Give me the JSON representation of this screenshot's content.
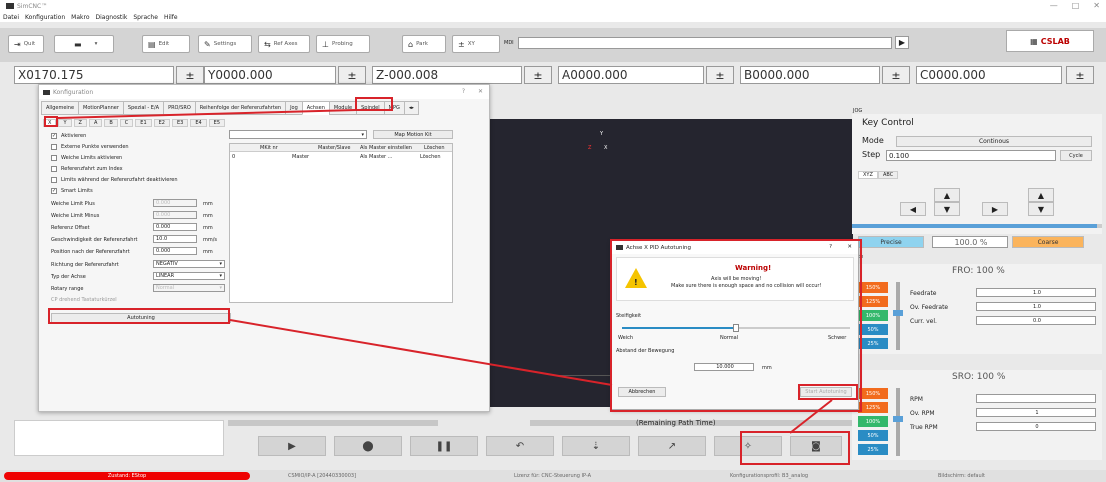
{
  "app": {
    "title": "SimCNC™"
  },
  "window_controls": {
    "minimize": "—",
    "maximize": "□",
    "close": "✕"
  },
  "menu": [
    "Datei",
    "Konfiguration",
    "Makro",
    "Diagnostik",
    "Sprache",
    "Hilfe"
  ],
  "toolbar": {
    "quit": "Quit",
    "edit": "Edit",
    "settings": "Settings",
    "ref_axes": "Ref Axes",
    "probing": "Probing",
    "park": "Park",
    "zero_xy": "XY",
    "mdi_label": "MDI"
  },
  "dro": [
    {
      "axis": "X",
      "value": "0170.175"
    },
    {
      "axis": "Y",
      "value": "0000.000"
    },
    {
      "axis": "Z",
      "value": "-000.008"
    },
    {
      "axis": "A",
      "value": "0000.000"
    },
    {
      "axis": "B",
      "value": "0000.000"
    },
    {
      "axis": "C",
      "value": "0000.000"
    }
  ],
  "config_dialog": {
    "title": "Konfiguration",
    "help": "?",
    "close": "✕",
    "tabs": [
      "Allgemeine",
      "MotionPlanner",
      "Spezial - E/A",
      "PRO/SRO",
      "Reihenfolge der Referenzfahrten",
      "Jog",
      "Achsen",
      "Module",
      "Spindel",
      "MPG"
    ],
    "subtabs": [
      "X",
      "Y",
      "Z",
      "A",
      "B",
      "C",
      "E1",
      "E2",
      "E3",
      "E4",
      "E5"
    ],
    "checks": [
      {
        "label": "Aktivieren",
        "checked": true
      },
      {
        "label": "Externe Punkte verwenden",
        "checked": false
      },
      {
        "label": "Weiche Limits aktivieren",
        "checked": false
      },
      {
        "label": "Referenzfahrt zum Index",
        "checked": false
      },
      {
        "label": "Limits während der Referenzfahrt deaktivieren",
        "checked": false
      },
      {
        "label": "Smart Limits",
        "checked": true
      }
    ],
    "fields": [
      {
        "label": "Weiche Limit Plus",
        "value": "0.000",
        "unit": "mm",
        "disabled": true
      },
      {
        "label": "Weiche Limit Minus",
        "value": "0.000",
        "unit": "mm",
        "disabled": true
      },
      {
        "label": "Referenz Offset",
        "value": "0.000",
        "unit": "mm",
        "disabled": false
      },
      {
        "label": "Geschwindigkeit der Referenzfahrt",
        "value": "10.0",
        "unit": "mm/s",
        "disabled": false
      },
      {
        "label": "Position nach der Referenzfahrt",
        "value": "0.000",
        "unit": "mm",
        "disabled": false
      }
    ],
    "selects": [
      {
        "label": "Richtung der Referenzfahrt",
        "value": "NEGATIV",
        "disabled": false
      },
      {
        "label": "Typ der Achse",
        "value": "LINEAR",
        "disabled": false
      },
      {
        "label": "Rotary range",
        "value": "Normal",
        "disabled": true
      }
    ],
    "extra_row": "CP drehend Tastaturkürzel",
    "autotuning": "Autotuning",
    "map_motion_kit": "Map Motion Kit",
    "table": {
      "headers": [
        "MKit nr",
        "Master/Slave",
        "Als Master einstellen",
        "Löschen"
      ],
      "rows": [
        [
          "0",
          "Master",
          "Als Master ...",
          "Löschen"
        ]
      ]
    }
  },
  "pid_dialog": {
    "title": "Achse X PID Autotuning",
    "help": "?",
    "close": "✕",
    "warning_title": "Warning!",
    "warning_line1": "Axis will be moving!",
    "warning_line2": "Make sure there is enough space and no collision will occur!",
    "stiffness_label": "Steifigkeit",
    "stiffness_level": 0.5,
    "slider_left": "Weich",
    "slider_mid": "Normal",
    "slider_right": "Schwer",
    "distance_label": "Abstand der Bewegung",
    "distance_value": "10.000",
    "distance_unit": "mm",
    "cancel": "Abbrechen",
    "start": "Start Autotuning"
  },
  "viewport": {
    "axis_y": "Y",
    "axis_z": "Z",
    "axis_x": "X"
  },
  "path_time": "(Remaining Path Time)",
  "jog": {
    "section": "JOG",
    "key_control": "Key Control",
    "mode_label": "Mode",
    "mode_value": "Continous",
    "step_label": "Step",
    "step_value": "0.100",
    "cycle": "Cycle",
    "tabs": [
      "XYZ",
      "ABC"
    ],
    "precise": "Precise",
    "percent": "100.0 %",
    "coarse": "Coarse"
  },
  "fro": {
    "section": "rate",
    "title": "FRO: 100 %",
    "buttons": [
      "150%",
      "125%",
      "100%",
      "50%",
      "25%"
    ],
    "feedrate_label": "Feedrate",
    "feedrate": "1.0",
    "ov_label": "Ov. Feedrate",
    "ov_feedrate": "1.0",
    "vel_label": "Curr. vel.",
    "vel": "0.0"
  },
  "sro": {
    "section": "le",
    "title": "SRO: 100 %",
    "buttons": [
      "150%",
      "125%",
      "100%",
      "50%",
      "25%"
    ],
    "rpm_label": "RPM",
    "rpm": "",
    "ov_label": "Ov. RPM",
    "ov_rpm": "1",
    "true_label": "True RPM",
    "true_rpm": "0"
  },
  "status": {
    "state": "Zustand: EStop",
    "device": "CSMIO/IP-A [20440330003]",
    "license": "Lizenz für: CNC-Steuerung IP-A",
    "profile": "Konfigurationsprofil: B3_analog",
    "screen": "Bildschirm: default"
  },
  "colors": {
    "highlight": "#d8232a",
    "orange": "#f26b1d",
    "green": "#33b86b",
    "blue": "#2a8cc4",
    "precise": "#8fd3ef",
    "coarse": "#fbb45c"
  }
}
